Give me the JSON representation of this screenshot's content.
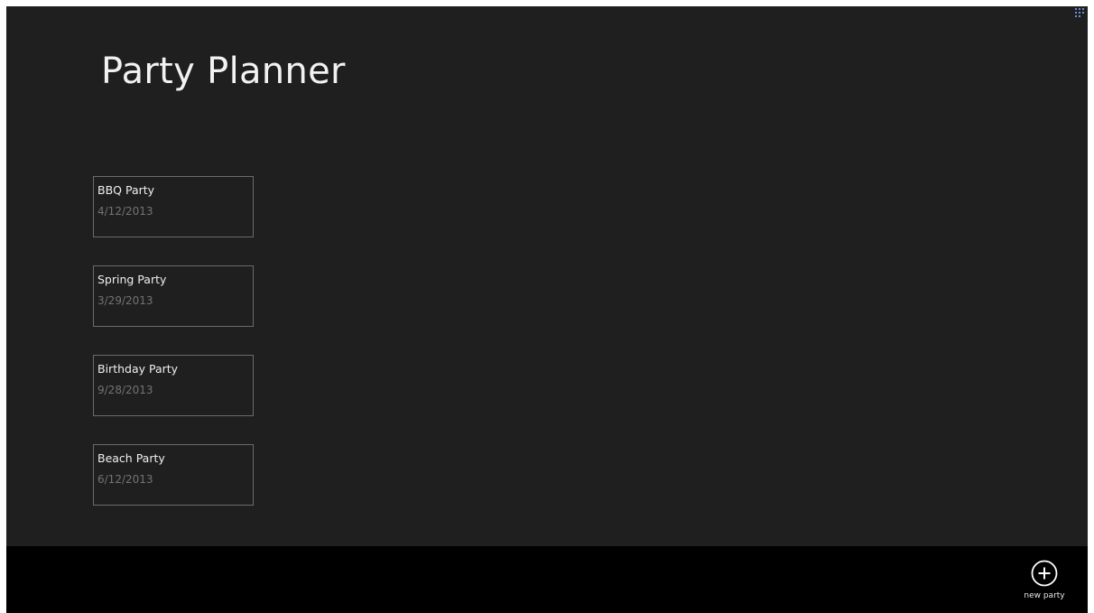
{
  "app": {
    "title": "Party Planner",
    "background_color": "#1f1f1f",
    "app_bar_color": "#000000"
  },
  "parties": [
    {
      "name": "BBQ Party",
      "date": "4/12/2013"
    },
    {
      "name": "Spring Party",
      "date": "3/29/2013"
    },
    {
      "name": "Birthday Party",
      "date": "9/28/2013"
    },
    {
      "name": "Beach Party",
      "date": "6/12/2013"
    }
  ],
  "app_bar": {
    "new_party": {
      "label": "new party",
      "icon": "plus-circle-icon"
    }
  }
}
